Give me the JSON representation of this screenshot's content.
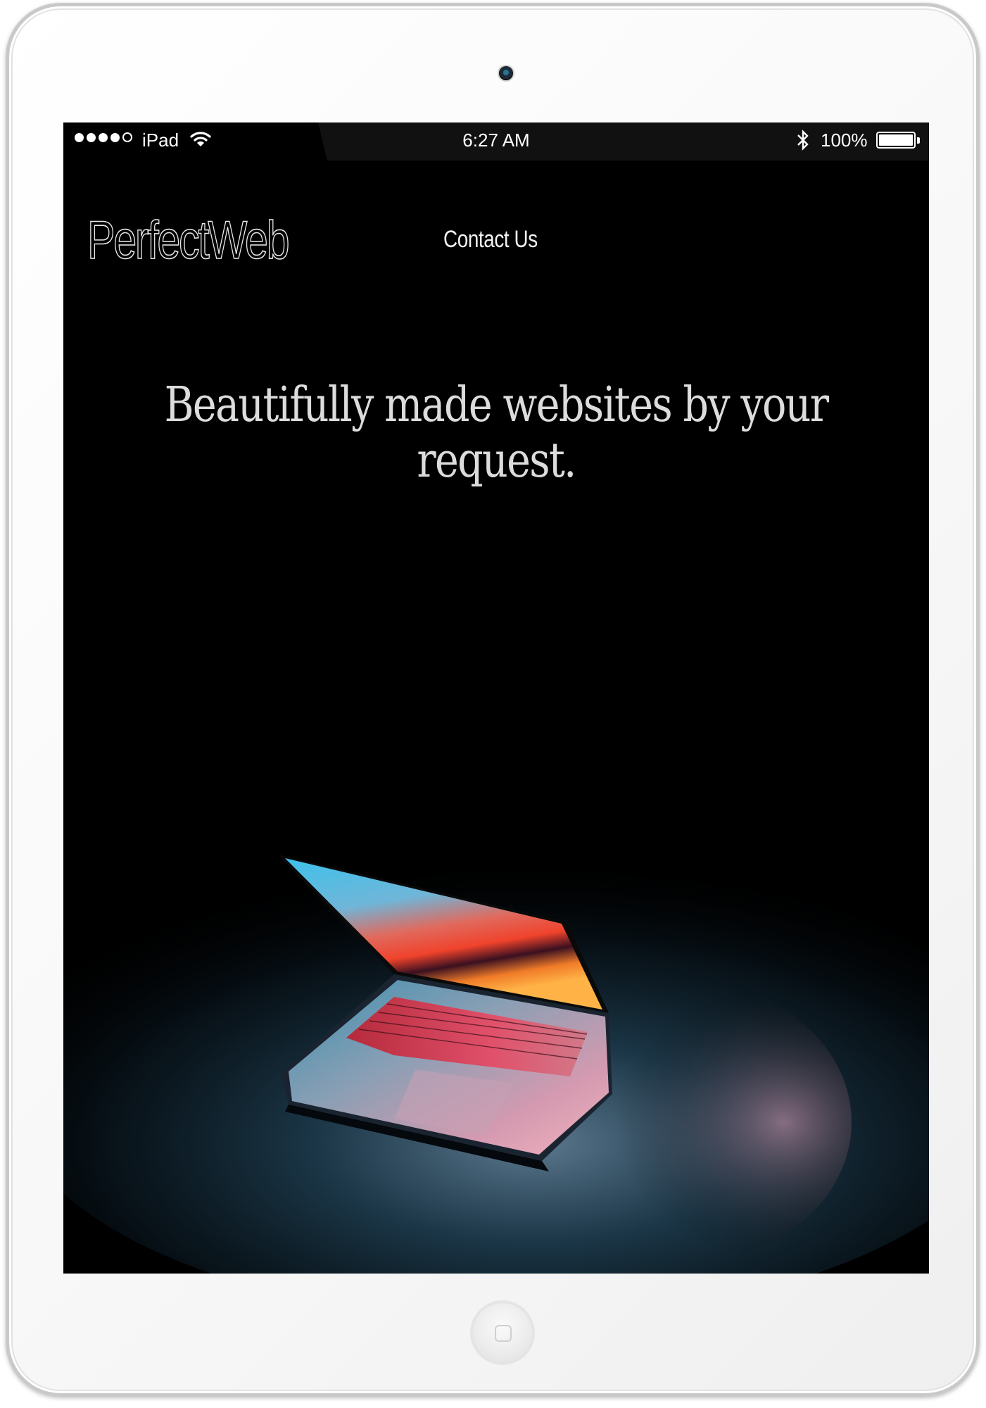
{
  "status_bar": {
    "carrier": "iPad",
    "time": "6:27 AM",
    "battery": "100%"
  },
  "header": {
    "logo": "PerfectWeb",
    "nav_contact": "Contact Us"
  },
  "hero": {
    "headline": "Beautifully made websites by your request."
  },
  "icons": {
    "wifi": "wifi-icon",
    "bluetooth": "bluetooth-icon",
    "battery": "battery-icon",
    "signal": "signal-strength-icon"
  },
  "colors": {
    "background": "#000000",
    "frame": "#ffffff",
    "headline": "#dcdcdc"
  }
}
